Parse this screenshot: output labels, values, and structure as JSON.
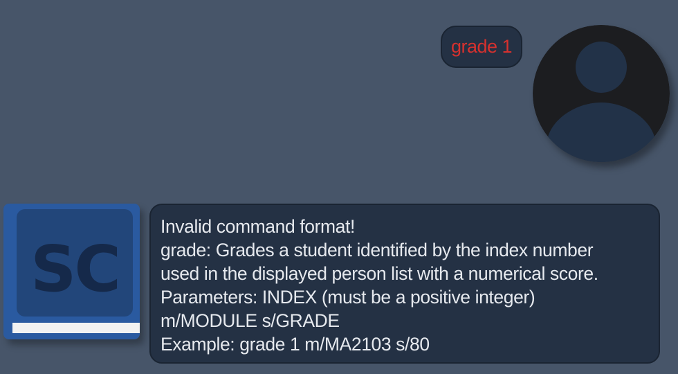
{
  "user_message": {
    "text": "grade 1"
  },
  "bot_message": {
    "lines": [
      "Invalid command format!",
      "grade: Grades a student identified by the index number",
      "used in the displayed person list with a numerical score.",
      "Parameters: INDEX (must be a positive integer)",
      "m/MODULE s/GRADE",
      "Example: grade 1 m/MA2103 s/80"
    ]
  },
  "bot_avatar": {
    "logo_text": "SC"
  },
  "icons": {
    "user_avatar": "person-silhouette-icon",
    "bot_avatar": "book-logo-icon"
  },
  "colors": {
    "background": "#475569",
    "bubble_background": "#243144",
    "user_text": "#d6312e",
    "bot_text": "#e6e9ee",
    "book_blue": "#2a5aa0"
  }
}
